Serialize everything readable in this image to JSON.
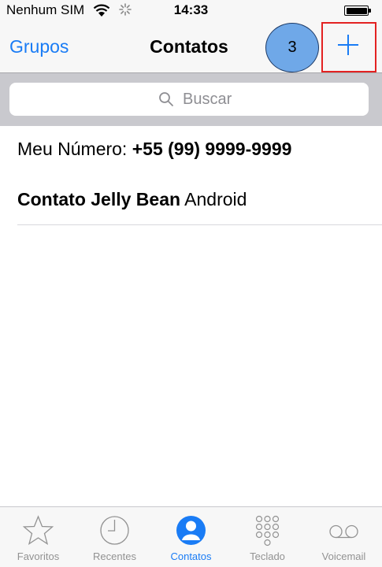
{
  "status_bar": {
    "carrier": "Nenhum SIM",
    "time": "14:33"
  },
  "nav": {
    "back_label": "Grupos",
    "title": "Contatos",
    "step_number": "3"
  },
  "search": {
    "placeholder": "Buscar"
  },
  "my_number": {
    "label": "Meu Número:",
    "value": "+55 (99) 9999-9999"
  },
  "contacts": [
    {
      "first_name": "Contato Jelly Bean",
      "last_name": "Android"
    }
  ],
  "tabs": [
    {
      "label": "Favoritos",
      "icon": "star-icon"
    },
    {
      "label": "Recentes",
      "icon": "clock-icon"
    },
    {
      "label": "Contatos",
      "icon": "contacts-icon",
      "active": true
    },
    {
      "label": "Teclado",
      "icon": "keypad-icon"
    },
    {
      "label": "Voicemail",
      "icon": "voicemail-icon"
    }
  ],
  "colors": {
    "accent": "#1a7cf5",
    "highlight_box": "#e32222",
    "step_badge": "#6fa8e8"
  }
}
